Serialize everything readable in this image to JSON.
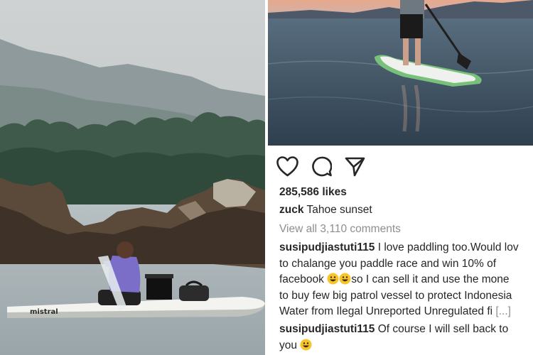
{
  "post": {
    "likes": "285,586 likes",
    "author": "zuck",
    "caption": "Tahoe sunset",
    "view_comments": "View all 3,110 comments"
  },
  "comments": [
    {
      "username": "susipudjiastuti115",
      "lines": [
        "I love paddling too.Would lov",
        "to chalange you paddle race and win 10% of",
        "facebook",
        "so I can sell it and use the mone",
        "to buy few big patrol vessel to protect Indonesia",
        "Water from Ilegal Unreported Unregulated fi"
      ],
      "more": "[...]"
    },
    {
      "username": "susipudjiastuti115",
      "lines": [
        "Of course I will sell back  to",
        "you"
      ]
    }
  ],
  "icons": {
    "like": "heart-icon",
    "comment": "comment-bubble-icon",
    "share": "send-paper-plane-icon",
    "emoji": "grinning-face-emoji"
  },
  "board_brand": "mistral",
  "colors": {
    "text": "#262626",
    "muted": "#8e8e8e",
    "emoji": "#f7c52b"
  }
}
